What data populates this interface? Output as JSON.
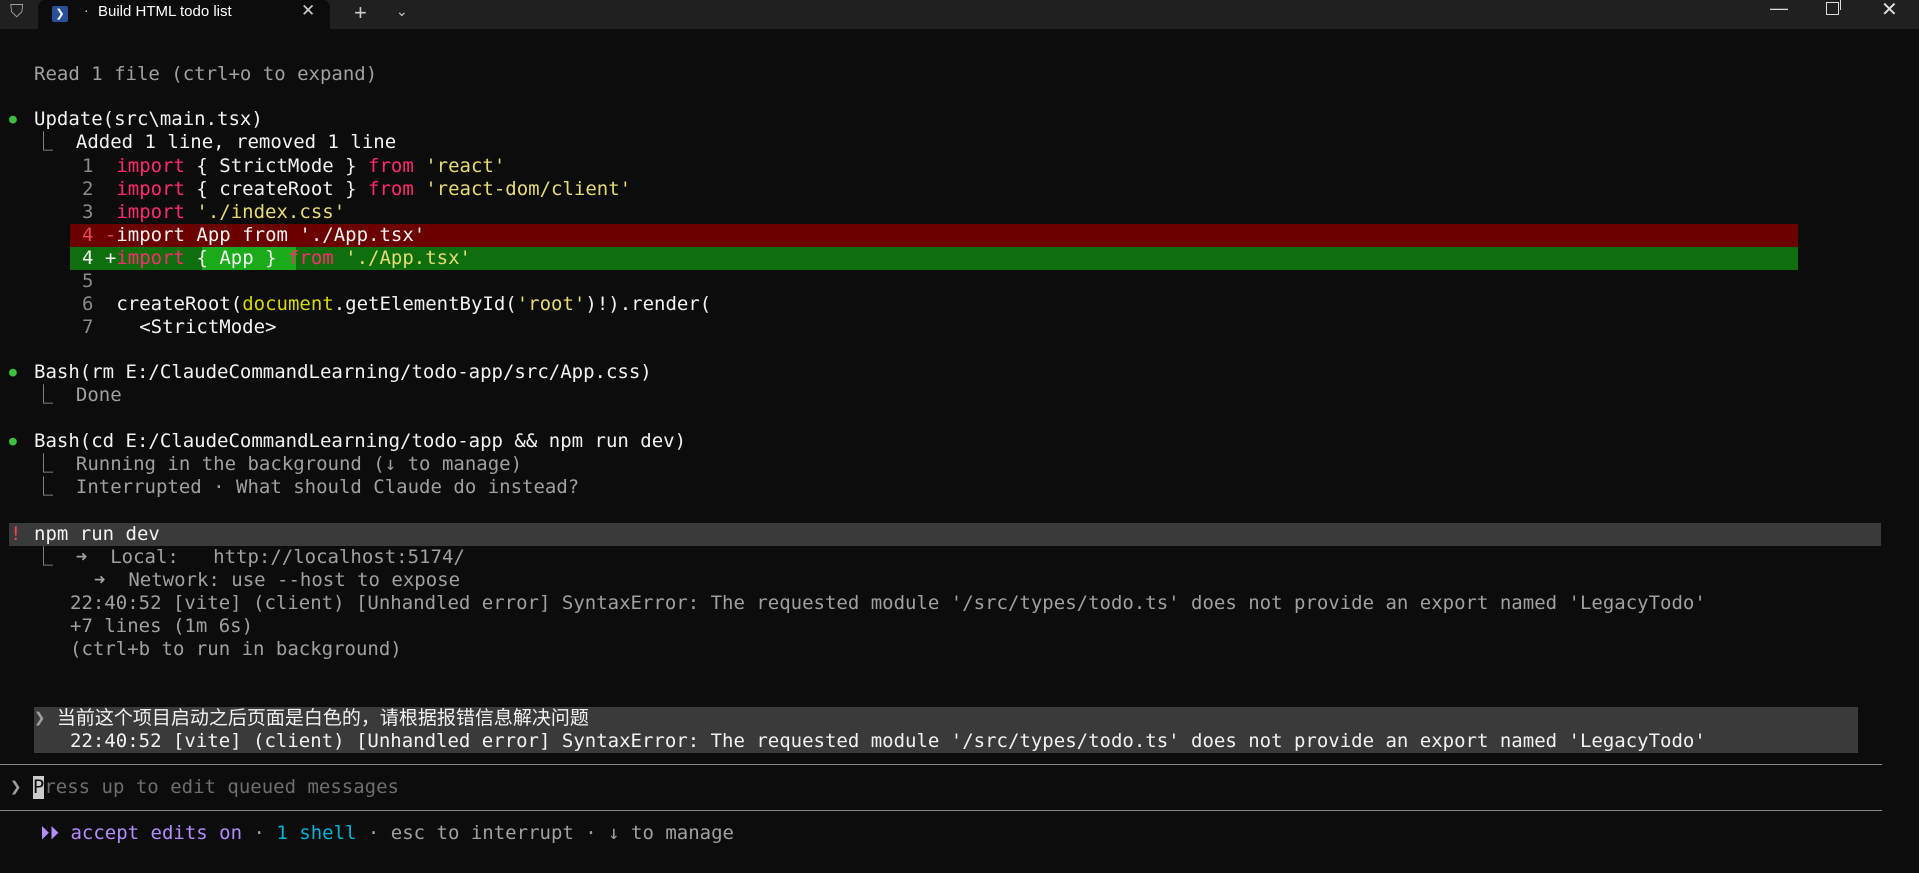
{
  "window": {
    "tab_title": "Build HTML todo list",
    "tab_dot": "·"
  },
  "terminal": {
    "read_line": "Read 1 file (ctrl+o to expand)",
    "update": {
      "header": "Update(src\\main.tsx)",
      "summary": "Added 1 line, removed 1 line",
      "lines": [
        {
          "num": "1",
          "parts": [
            "import",
            " { StrictMode } ",
            "from",
            " 'react'"
          ]
        },
        {
          "num": "2",
          "parts": [
            "import",
            " { createRoot } ",
            "from",
            " 'react-dom/client'"
          ]
        },
        {
          "num": "3",
          "parts": [
            "import",
            " './index.css'"
          ]
        },
        {
          "num": "4",
          "marker": "-",
          "text": "import App from './App.tsx'"
        },
        {
          "num": "4",
          "marker": "+",
          "parts": [
            "import",
            " { App } ",
            "from",
            " './App.tsx'"
          ]
        },
        {
          "num": "5"
        },
        {
          "num": "6",
          "parts": [
            "createRoot(",
            "document",
            ".getElementById(",
            "'root'",
            ")!).render("
          ]
        },
        {
          "num": "7",
          "text": "  <StrictMode>"
        }
      ]
    },
    "bash1": {
      "header": "Bash(rm E:/ClaudeCommandLearning/todo-app/src/App.css)",
      "result": "Done"
    },
    "bash2": {
      "header": "Bash(cd E:/ClaudeCommandLearning/todo-app && npm run dev)",
      "result1": "Running in the background (↓ to manage)",
      "result2": "Interrupted · What should Claude do instead?"
    },
    "shell": {
      "mark": "!",
      "command": "npm run dev",
      "local": "➜  Local:   http://localhost:5174/",
      "network": "➜  Network: use --host to expose",
      "error": "22:40:52 [vite] (client) [Unhandled error] SyntaxError: The requested module '/src/types/todo.ts' does not provide an export named 'LegacyTodo'",
      "more": "+7 lines (1m 6s)",
      "hint": "(ctrl+b to run in background)"
    },
    "queued": {
      "message": "当前这个项目启动之后页面是白色的，请根据报错信息解决问题",
      "error": "22:40:52 [vite] (client) [Unhandled error] SyntaxError: The requested module '/src/types/todo.ts' does not provide an export named 'LegacyTodo'"
    },
    "prompt": {
      "arrow": "❯",
      "cursor_char": "P",
      "placeholder": "ress up to edit queued messages"
    },
    "status": {
      "icon": "⏵⏵",
      "mode": "accept edits on",
      "sep": " · ",
      "shells": "1 shell",
      "interrupt": "esc to interrupt",
      "manage": "↓ to manage"
    }
  }
}
